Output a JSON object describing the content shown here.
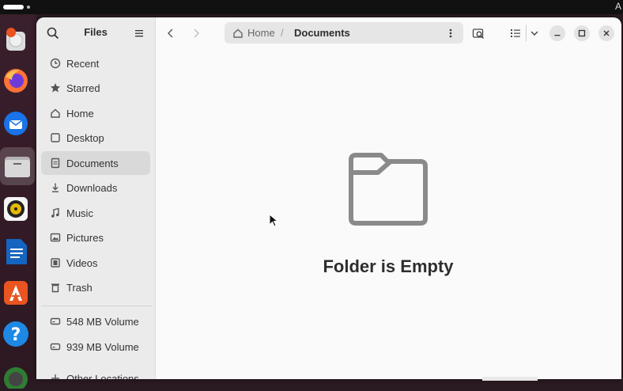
{
  "topbar": {
    "letter": "A"
  },
  "dock": {
    "items": [
      {
        "name": "ubuntu-logo-icon"
      },
      {
        "name": "firefox-icon"
      },
      {
        "name": "thunderbird-icon"
      },
      {
        "name": "files-icon"
      },
      {
        "name": "rhythmbox-icon"
      },
      {
        "name": "libreoffice-writer-icon"
      },
      {
        "name": "app-center-icon"
      },
      {
        "name": "help-icon"
      },
      {
        "name": "app-grid-icon"
      }
    ]
  },
  "sidebar": {
    "title": "Files",
    "items": [
      {
        "label": "Recent",
        "icon": "clock-icon"
      },
      {
        "label": "Starred",
        "icon": "star-icon"
      },
      {
        "label": "Home",
        "icon": "home-icon"
      },
      {
        "label": "Desktop",
        "icon": "desktop-icon"
      },
      {
        "label": "Documents",
        "icon": "document-icon",
        "selected": true
      },
      {
        "label": "Downloads",
        "icon": "download-icon"
      },
      {
        "label": "Music",
        "icon": "music-icon"
      },
      {
        "label": "Pictures",
        "icon": "pictures-icon"
      },
      {
        "label": "Videos",
        "icon": "videos-icon"
      },
      {
        "label": "Trash",
        "icon": "trash-icon"
      }
    ],
    "volumes": [
      {
        "label": "548 MB Volume",
        "icon": "drive-icon"
      },
      {
        "label": "939 MB Volume",
        "icon": "drive-icon"
      }
    ],
    "other_locations": "Other Locations"
  },
  "pathbar": {
    "home": "Home",
    "separator": "/",
    "current": "Documents"
  },
  "empty": {
    "title": "Folder is Empty"
  }
}
